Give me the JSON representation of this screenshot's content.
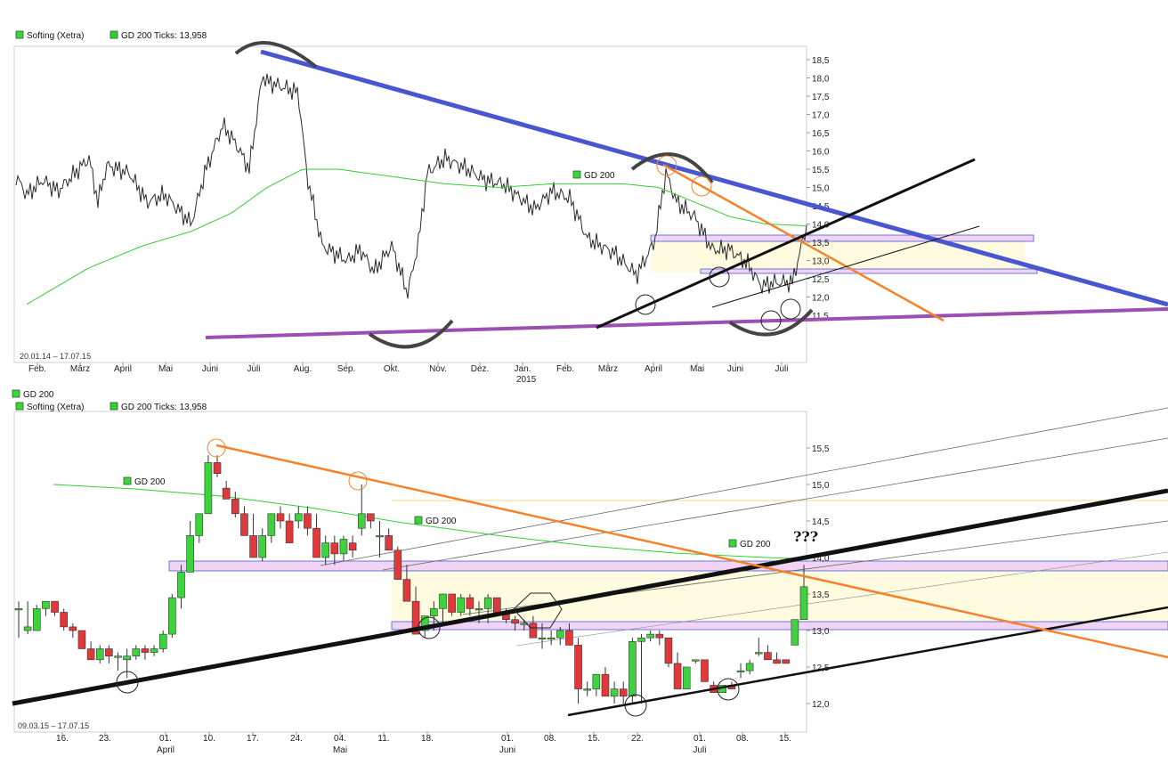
{
  "colors": {
    "up": "#3fd23f",
    "down": "#e0393b",
    "gd200": "#33cc33",
    "blue_trend": "#4a55d0",
    "purple_trend": "#9b4fb0",
    "orange_trend": "#f5822a",
    "zone_fill": "#fffbe0",
    "band_fill": "#f3d3f3",
    "band_stroke": "#3f5fd6"
  },
  "top": {
    "legend": [
      "Softing (Xetra)",
      "GD 200 Ticks: 13,958"
    ],
    "range_text": "20.01.14 – 17.07.15",
    "gd_label": "GD 200",
    "y_ticks": [
      "18,5",
      "18,0",
      "17,5",
      "17,0",
      "16,5",
      "16,0",
      "15,5",
      "15,0",
      "14,5",
      "14,0",
      "13,5",
      "13,0",
      "12,5",
      "12,0",
      "11,5"
    ],
    "x_ticks": [
      "Feb.",
      "März",
      "April",
      "Mai",
      "Juni",
      "Juli",
      "Aug.",
      "Sep.",
      "Okt.",
      "Nov.",
      "Dez.",
      "Jan.",
      "Feb.",
      "März",
      "April",
      "Mai",
      "Juni",
      "Juli"
    ],
    "year_label": "2015"
  },
  "bottom": {
    "indicator_label": "GD 200",
    "legend": [
      "Softing (Xetra)",
      "GD 200 Ticks: 13,958"
    ],
    "range_text": "09.03.15 – 17.07.15",
    "gd_labels": [
      "GD 200",
      "GD 200",
      "GD 200"
    ],
    "question": "???",
    "y_ticks": [
      "15,5",
      "15,0",
      "14,5",
      "14,0",
      "13,5",
      "13,0",
      "12,5",
      "12,0"
    ],
    "x_ticks": [
      "16.",
      "23.",
      "01.",
      "10.",
      "17.",
      "24.",
      "04.",
      "11.",
      "18.",
      "01.",
      "08.",
      "15.",
      "22.",
      "01.",
      "08.",
      "15."
    ],
    "month_labels": [
      "April",
      "Mai",
      "Juni",
      "Juli"
    ]
  },
  "chart_data": [
    {
      "type": "line",
      "title": "Softing (Xetra)",
      "period": "20.01.14 – 17.07.15",
      "ylim": [
        11.2,
        18.8
      ],
      "series": [
        {
          "name": "Softing (Xetra)",
          "x": [
            "20.01.14",
            "Feb.",
            "März",
            "April",
            "Mai",
            "Juni",
            "Juli",
            "Aug.",
            "Sep.",
            "Okt.",
            "Nov.",
            "Dez.",
            "Jan.",
            "Feb.",
            "März",
            "April",
            "Mai",
            "Juni",
            "Juli",
            "17.07.15"
          ],
          "values": [
            15.3,
            14.9,
            15.9,
            15.5,
            14.4,
            15.8,
            18.0,
            15.3,
            13.4,
            12.1,
            15.6,
            15.1,
            14.7,
            13.6,
            13.0,
            15.3,
            13.2,
            12.2,
            12.4,
            13.95
          ]
        },
        {
          "name": "GD 200",
          "x": [
            "20.01.14",
            "Feb.",
            "März",
            "April",
            "Mai",
            "Juni",
            "Juli",
            "Aug.",
            "Sep.",
            "Okt.",
            "Nov.",
            "Dez.",
            "Jan.",
            "Feb.",
            "März",
            "April",
            "Mai",
            "Juni",
            "Juli",
            "17.07.15"
          ],
          "values": [
            11.8,
            12.8,
            13.4,
            13.8,
            14.2,
            14.9,
            15.5,
            15.5,
            15.3,
            15.1,
            15.0,
            15.0,
            15.1,
            15.1,
            15.1,
            15.0,
            14.3,
            14.0,
            13.95,
            13.958
          ]
        }
      ]
    },
    {
      "type": "candlestick",
      "title": "Softing (Xetra)",
      "period": "09.03.15 – 17.07.15",
      "ylim": [
        11.8,
        15.8
      ],
      "series": [
        {
          "name": "Softing (Xetra)",
          "values": [
            [
              13.3,
              13.4,
              12.9,
              13.3
            ],
            [
              13.0,
              13.4,
              12.95,
              13.05
            ],
            [
              13.0,
              13.35,
              13.0,
              13.3
            ],
            [
              13.3,
              13.4,
              13.2,
              13.4
            ],
            [
              13.4,
              13.4,
              13.2,
              13.25
            ],
            [
              13.25,
              13.3,
              13.0,
              13.05
            ],
            [
              13.05,
              13.1,
              12.9,
              13.0
            ],
            [
              13.0,
              13.0,
              12.8,
              12.75
            ],
            [
              12.75,
              12.85,
              12.6,
              12.6
            ],
            [
              12.6,
              12.8,
              12.55,
              12.75
            ],
            [
              12.75,
              12.8,
              12.55,
              12.65
            ],
            [
              12.65,
              12.7,
              12.45,
              12.65
            ],
            [
              12.6,
              12.75,
              12.35,
              12.65
            ],
            [
              12.65,
              12.8,
              12.6,
              12.75
            ],
            [
              12.75,
              12.8,
              12.6,
              12.7
            ],
            [
              12.7,
              12.8,
              12.65,
              12.75
            ],
            [
              12.75,
              13.0,
              12.7,
              12.95
            ],
            [
              12.95,
              13.5,
              12.9,
              13.45
            ],
            [
              13.45,
              13.9,
              13.3,
              13.8
            ],
            [
              13.8,
              14.5,
              13.8,
              14.3
            ],
            [
              14.3,
              14.6,
              14.2,
              14.6
            ],
            [
              14.6,
              15.4,
              14.6,
              15.3
            ],
            [
              15.3,
              15.4,
              15.1,
              15.15
            ],
            [
              14.95,
              15.05,
              14.85,
              14.8
            ],
            [
              14.8,
              14.9,
              14.55,
              14.6
            ],
            [
              14.6,
              14.7,
              14.3,
              14.3
            ],
            [
              14.3,
              14.6,
              14.0,
              14.0
            ],
            [
              14.0,
              14.4,
              13.95,
              14.3
            ],
            [
              14.3,
              14.6,
              14.2,
              14.6
            ],
            [
              14.6,
              14.7,
              14.4,
              14.5
            ],
            [
              14.5,
              14.6,
              14.2,
              14.2
            ],
            [
              14.5,
              14.7,
              14.4,
              14.6
            ],
            [
              14.6,
              14.7,
              14.3,
              14.4
            ],
            [
              14.4,
              14.6,
              14.0,
              14.0
            ],
            [
              14.0,
              14.3,
              13.9,
              14.2
            ],
            [
              14.2,
              14.3,
              13.9,
              14.05
            ],
            [
              14.05,
              14.3,
              13.95,
              14.25
            ],
            [
              14.2,
              14.3,
              14.0,
              14.1
            ],
            [
              14.4,
              15.0,
              14.3,
              14.6
            ],
            [
              14.6,
              14.6,
              14.4,
              14.5
            ],
            [
              14.3,
              14.5,
              14.0,
              14.3
            ],
            [
              14.3,
              14.4,
              14.1,
              14.1
            ],
            [
              14.1,
              14.15,
              13.8,
              13.7
            ],
            [
              13.7,
              13.9,
              13.6,
              13.4
            ],
            [
              13.4,
              13.6,
              13.0,
              12.95
            ],
            [
              13.0,
              13.2,
              12.9,
              13.2
            ],
            [
              13.2,
              13.4,
              13.0,
              13.3
            ],
            [
              13.3,
              13.5,
              13.1,
              13.5
            ],
            [
              13.5,
              13.5,
              13.2,
              13.25
            ],
            [
              13.25,
              13.5,
              13.2,
              13.45
            ],
            [
              13.45,
              13.5,
              13.2,
              13.3
            ],
            [
              13.3,
              13.4,
              13.1,
              13.3
            ],
            [
              13.3,
              13.5,
              13.1,
              13.45
            ],
            [
              13.45,
              13.45,
              13.2,
              13.25
            ],
            [
              13.25,
              13.3,
              13.1,
              13.15
            ],
            [
              13.15,
              13.2,
              13.0,
              13.1
            ],
            [
              13.1,
              13.15,
              13.0,
              13.1
            ],
            [
              13.1,
              13.2,
              12.9,
              12.9
            ],
            [
              12.9,
              13.1,
              12.75,
              12.9
            ],
            [
              12.9,
              13.0,
              12.8,
              12.9
            ],
            [
              12.9,
              13.05,
              12.8,
              13.0
            ],
            [
              13.0,
              13.1,
              12.8,
              12.8
            ],
            [
              12.8,
              12.9,
              12.0,
              12.2
            ],
            [
              12.2,
              12.3,
              12.1,
              12.2
            ],
            [
              12.2,
              12.4,
              12.1,
              12.4
            ],
            [
              12.4,
              12.5,
              12.1,
              12.1
            ],
            [
              12.1,
              12.3,
              12.0,
              12.2
            ],
            [
              12.2,
              12.3,
              12.0,
              12.1
            ],
            [
              12.1,
              12.9,
              12.0,
              12.85
            ],
            [
              12.85,
              12.95,
              12.0,
              12.9
            ],
            [
              12.9,
              13.0,
              12.85,
              12.95
            ],
            [
              12.95,
              13.0,
              12.8,
              12.9
            ],
            [
              12.9,
              12.9,
              12.5,
              12.55
            ],
            [
              12.55,
              12.7,
              12.2,
              12.2
            ],
            [
              12.2,
              12.5,
              12.2,
              12.5
            ],
            [
              12.6,
              12.6,
              12.55,
              12.6
            ],
            [
              12.6,
              12.6,
              12.35,
              12.3
            ],
            [
              12.25,
              12.3,
              12.2,
              12.15
            ],
            [
              12.15,
              12.25,
              12.15,
              12.25
            ],
            [
              12.25,
              12.3,
              12.2,
              12.2
            ],
            [
              12.45,
              12.55,
              12.35,
              12.45
            ],
            [
              12.45,
              12.6,
              12.4,
              12.55
            ],
            [
              12.7,
              12.9,
              12.65,
              12.7
            ],
            [
              12.7,
              12.8,
              12.6,
              12.6
            ],
            [
              12.6,
              12.7,
              12.55,
              12.55
            ],
            [
              12.6,
              12.6,
              12.55,
              12.55
            ],
            [
              12.8,
              13.15,
              12.8,
              13.15
            ],
            [
              13.15,
              13.9,
              13.15,
              13.6
            ]
          ]
        },
        {
          "name": "GD 200",
          "x": [
            "09.03.15",
            "01.04",
            "17.04",
            "01.05",
            "15.05",
            "01.06",
            "15.06",
            "01.07",
            "17.07.15"
          ],
          "values": [
            15.0,
            14.88,
            14.75,
            14.58,
            14.4,
            14.2,
            14.08,
            14.02,
            13.958
          ]
        }
      ]
    }
  ]
}
